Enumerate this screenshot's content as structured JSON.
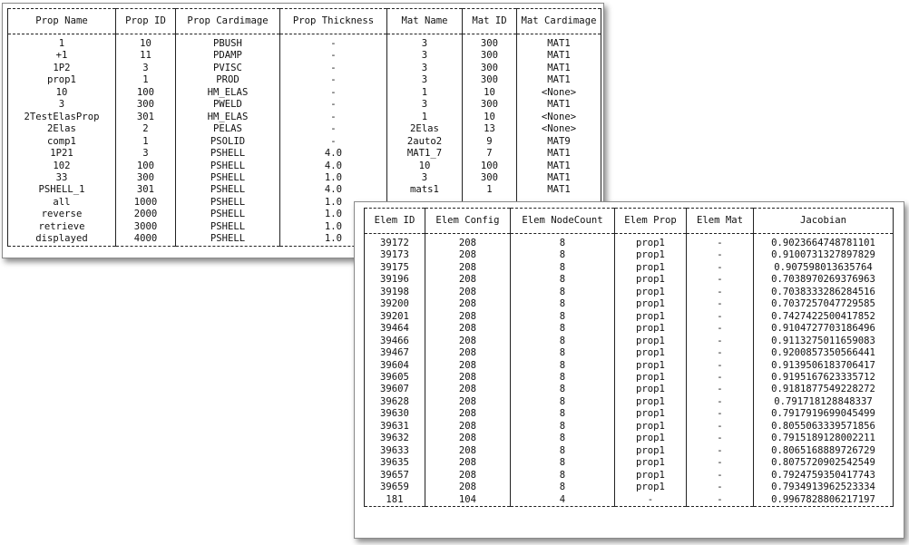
{
  "prop_table": {
    "headers": [
      "Prop Name",
      "Prop ID",
      "Prop Cardimage",
      "Prop Thickness",
      "Mat Name",
      "Mat ID",
      "Mat Cardimage"
    ],
    "rows": [
      [
        "1",
        "10",
        "PBUSH",
        "-",
        "3",
        "300",
        "MAT1"
      ],
      [
        "+1",
        "11",
        "PDAMP",
        "-",
        "3",
        "300",
        "MAT1"
      ],
      [
        "1P2",
        "3",
        "PVISC",
        "-",
        "3",
        "300",
        "MAT1"
      ],
      [
        "prop1",
        "1",
        "PROD",
        "-",
        "3",
        "300",
        "MAT1"
      ],
      [
        "10",
        "100",
        "HM_ELAS",
        "-",
        "1",
        "10",
        "<None>"
      ],
      [
        "3",
        "300",
        "PWELD",
        "-",
        "3",
        "300",
        "MAT1"
      ],
      [
        "2TestElasProp",
        "301",
        "HM_ELAS",
        "-",
        "1",
        "10",
        "<None>"
      ],
      [
        "2Elas",
        "2",
        "PELAS",
        "-",
        "2Elas",
        "13",
        "<None>"
      ],
      [
        "comp1",
        "1",
        "PSOLID",
        "-",
        "2auto2",
        "9",
        "MAT9"
      ],
      [
        "1P21",
        "3",
        "PSHELL",
        "4.0",
        "MAT1_7",
        "7",
        "MAT1"
      ],
      [
        "102",
        "100",
        "PSHELL",
        "4.0",
        "10",
        "100",
        "MAT1"
      ],
      [
        "33",
        "300",
        "PSHELL",
        "1.0",
        "3",
        "300",
        "MAT1"
      ],
      [
        "PSHELL_1",
        "301",
        "PSHELL",
        "4.0",
        "mats1",
        "1",
        "MAT1"
      ],
      [
        "all",
        "1000",
        "PSHELL",
        "1.0",
        "",
        "",
        ""
      ],
      [
        "reverse",
        "2000",
        "PSHELL",
        "1.0",
        "",
        "",
        ""
      ],
      [
        "retrieve",
        "3000",
        "PSHELL",
        "1.0",
        "",
        "",
        ""
      ],
      [
        "displayed",
        "4000",
        "PSHELL",
        "1.0",
        "",
        "",
        ""
      ]
    ]
  },
  "elem_table": {
    "headers": [
      "Elem ID",
      "Elem Config",
      "Elem NodeCount",
      "Elem Prop",
      "Elem Mat",
      "Jacobian"
    ],
    "rows": [
      [
        "39172",
        "208",
        "8",
        "prop1",
        "-",
        "0.9023664748781101"
      ],
      [
        "39173",
        "208",
        "8",
        "prop1",
        "-",
        "0.9100731327897829"
      ],
      [
        "39175",
        "208",
        "8",
        "prop1",
        "-",
        "0.907598013635764"
      ],
      [
        "39196",
        "208",
        "8",
        "prop1",
        "-",
        "0.7038970269376963"
      ],
      [
        "39198",
        "208",
        "8",
        "prop1",
        "-",
        "0.7038333286284516"
      ],
      [
        "39200",
        "208",
        "8",
        "prop1",
        "-",
        "0.7037257047729585"
      ],
      [
        "39201",
        "208",
        "8",
        "prop1",
        "-",
        "0.7427422500417852"
      ],
      [
        "39464",
        "208",
        "8",
        "prop1",
        "-",
        "0.9104727703186496"
      ],
      [
        "39466",
        "208",
        "8",
        "prop1",
        "-",
        "0.9113275011659083"
      ],
      [
        "39467",
        "208",
        "8",
        "prop1",
        "-",
        "0.9200857350566441"
      ],
      [
        "39604",
        "208",
        "8",
        "prop1",
        "-",
        "0.9139506183706417"
      ],
      [
        "39605",
        "208",
        "8",
        "prop1",
        "-",
        "0.9195167623335712"
      ],
      [
        "39607",
        "208",
        "8",
        "prop1",
        "-",
        "0.9181877549228272"
      ],
      [
        "39628",
        "208",
        "8",
        "prop1",
        "-",
        "0.791718128848337"
      ],
      [
        "39630",
        "208",
        "8",
        "prop1",
        "-",
        "0.7917919699045499"
      ],
      [
        "39631",
        "208",
        "8",
        "prop1",
        "-",
        "0.8055063339571856"
      ],
      [
        "39632",
        "208",
        "8",
        "prop1",
        "-",
        "0.7915189128002211"
      ],
      [
        "39633",
        "208",
        "8",
        "prop1",
        "-",
        "0.8065168889726729"
      ],
      [
        "39635",
        "208",
        "8",
        "prop1",
        "-",
        "0.8075720902542549"
      ],
      [
        "39657",
        "208",
        "8",
        "prop1",
        "-",
        "0.7924759350417743"
      ],
      [
        "39659",
        "208",
        "8",
        "prop1",
        "-",
        "0.7934913962523334"
      ],
      [
        "181",
        "104",
        "4",
        "-",
        "-",
        "0.9967828806217197"
      ]
    ]
  }
}
